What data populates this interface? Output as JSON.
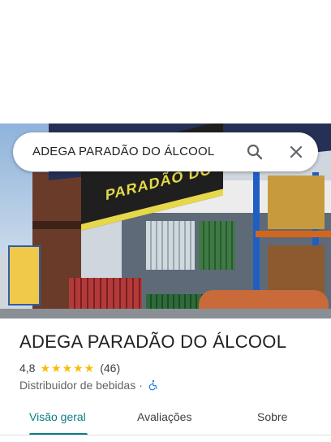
{
  "search": {
    "query": "ADEGA PARADÃO DO ÁLCOOL",
    "search_icon": "search-icon",
    "close_icon": "close-icon"
  },
  "hero": {
    "sign_text": "PARADÃO DO"
  },
  "place": {
    "title": "ADEGA PARADÃO DO ÁLCOOL",
    "rating": "4,8",
    "stars": "★★★★★",
    "star_count": 5,
    "review_count": "(46)",
    "category": "Distribuidor de bebidas",
    "separator": "·",
    "accessibility_icon": "wheelchair-icon"
  },
  "tabs": [
    {
      "label": "Visão geral",
      "active": true
    },
    {
      "label": "Avaliações",
      "active": false
    },
    {
      "label": "Sobre",
      "active": false
    }
  ],
  "colors": {
    "accent": "#0b7c84",
    "star": "#fbbc04",
    "wheelchair": "#1a73e8"
  }
}
